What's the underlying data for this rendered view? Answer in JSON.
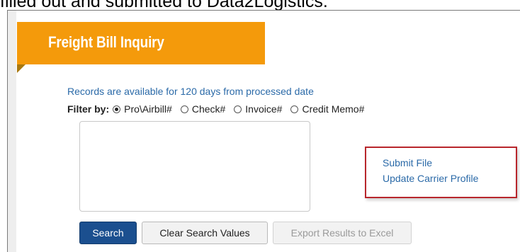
{
  "caption": {
    "text": "filled out and submitted to Data2Logistics."
  },
  "banner": {
    "title": "Freight Bill Inquiry",
    "color": "#f49a0b"
  },
  "notice": {
    "text": "Records are available for 120 days from processed date"
  },
  "filter": {
    "label": "Filter by:",
    "options": [
      {
        "label": "Pro\\Airbill#",
        "selected": true
      },
      {
        "label": "Check#",
        "selected": false
      },
      {
        "label": "Invoice#",
        "selected": false
      },
      {
        "label": "Credit Memo#",
        "selected": false
      }
    ]
  },
  "search_input": {
    "value": ""
  },
  "links": {
    "submit_file": "Submit File",
    "update_carrier_profile": "Update Carrier Profile",
    "highlight_color": "#b8262c"
  },
  "buttons": {
    "search": "Search",
    "clear": "Clear Search Values",
    "export": "Export Results to Excel"
  },
  "colors": {
    "link": "#2b6aa8",
    "primary_button": "#1b4f8f"
  }
}
